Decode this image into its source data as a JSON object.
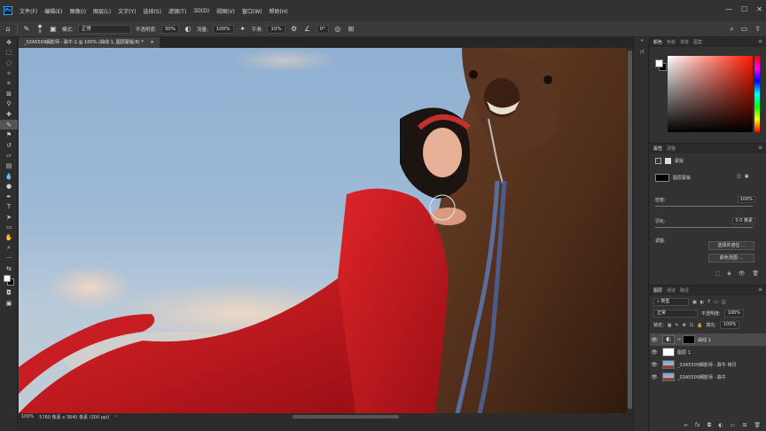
{
  "menubar": {
    "logo": "Ps",
    "items": [
      "文件(F)",
      "编辑(E)",
      "图像(I)",
      "图层(L)",
      "文字(Y)",
      "选择(S)",
      "滤镜(T)",
      "3D(D)",
      "视图(V)",
      "窗口(W)",
      "帮助(H)"
    ]
  },
  "options": {
    "brush_size": "9",
    "mode_label": "模式:",
    "mode_value": "正常",
    "opacity_label": "不透明度:",
    "opacity_value": "30%",
    "flow_label": "流量:",
    "flow_value": "100%",
    "smooth_label": "平滑:",
    "smooth_value": "10%",
    "angle_value": "0°"
  },
  "document": {
    "tab_title": "_S3A5509搁影师 - 跌牛-1 @ 100% (曲线 1, 图层蒙版/8) *"
  },
  "status": {
    "zoom": "100%",
    "size": "5760 像素 x 3840 像素 (300 ppi)"
  },
  "color_panel": {
    "tabs": [
      "颜色",
      "色板",
      "渐变",
      "图案"
    ],
    "fg_color": "#ffffff",
    "bg_color": "#000000"
  },
  "properties": {
    "tabs": [
      "属性",
      "调整"
    ],
    "header": "蒙版",
    "mask_label": "图层蒙版",
    "density_label": "密度:",
    "density_value": "100%",
    "feather_label": "羽化:",
    "feather_value": "0.0 像素",
    "refine_label": "调整:",
    "select_and_mask": "选择并遮住 ...",
    "color_range": "颜色范围 ..."
  },
  "layers": {
    "tabs": [
      "图层",
      "通道",
      "路径"
    ],
    "kind_label": "类型",
    "blend_mode": "正常",
    "opacity_label": "不透明度:",
    "opacity_value": "100%",
    "lock_label": "锁定:",
    "fill_label": "填充:",
    "fill_value": "100%",
    "items": [
      {
        "name": "曲线 1"
      },
      {
        "name": "图层 1"
      },
      {
        "name": "_S3A5509搁影师 - 跌牛 拷贝"
      },
      {
        "name": "_S3A5509搁影师 - 跌牛"
      }
    ]
  }
}
